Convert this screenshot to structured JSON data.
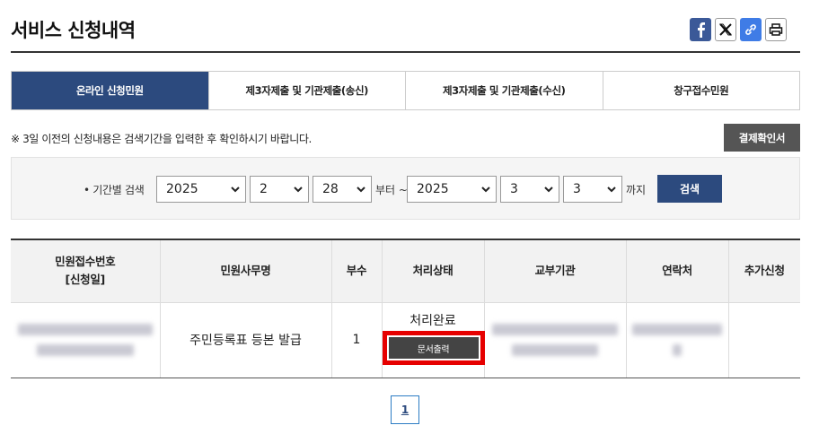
{
  "page": {
    "title": "서비스 신청내역"
  },
  "share": {
    "facebook_icon": "facebook-icon",
    "x_icon": "x-icon",
    "link_icon": "link-icon",
    "print_icon": "printer-icon"
  },
  "tabs": [
    {
      "label": "온라인 신청민원",
      "active": true
    },
    {
      "label": "제3자제출 및 기관제출(송신)",
      "active": false
    },
    {
      "label": "제3자제출 및 기관제출(수신)",
      "active": false
    },
    {
      "label": "창구접수민원",
      "active": false
    }
  ],
  "notice": "※ 3일 이전의 신청내용은 검색기간을 입력한 후 확인하시기 바랍니다.",
  "pay_button": "결제확인서",
  "search": {
    "label": "• 기간별 검색",
    "from_year": "2025",
    "from_month": "2",
    "from_day": "28",
    "from_suffix": "부터 ~",
    "to_year": "2025",
    "to_month": "3",
    "to_day": "3",
    "to_suffix": "까지",
    "button": "검색"
  },
  "table": {
    "headers": {
      "receipt_no_line1": "민원접수번호",
      "receipt_no_line2": "[신청일]",
      "service_name": "민원사무명",
      "copies": "부수",
      "status": "처리상태",
      "agency": "교부기관",
      "contact": "연락처",
      "extra": "추가신청"
    },
    "rows": [
      {
        "service_name": "주민등록표 등본 발급",
        "copies": "1",
        "status": "처리완료",
        "print_button": "문서출력"
      }
    ]
  },
  "pagination": {
    "current": "1"
  },
  "colors": {
    "accent": "#2c4a7e",
    "highlight": "#e60000",
    "dark_button": "#444444"
  }
}
